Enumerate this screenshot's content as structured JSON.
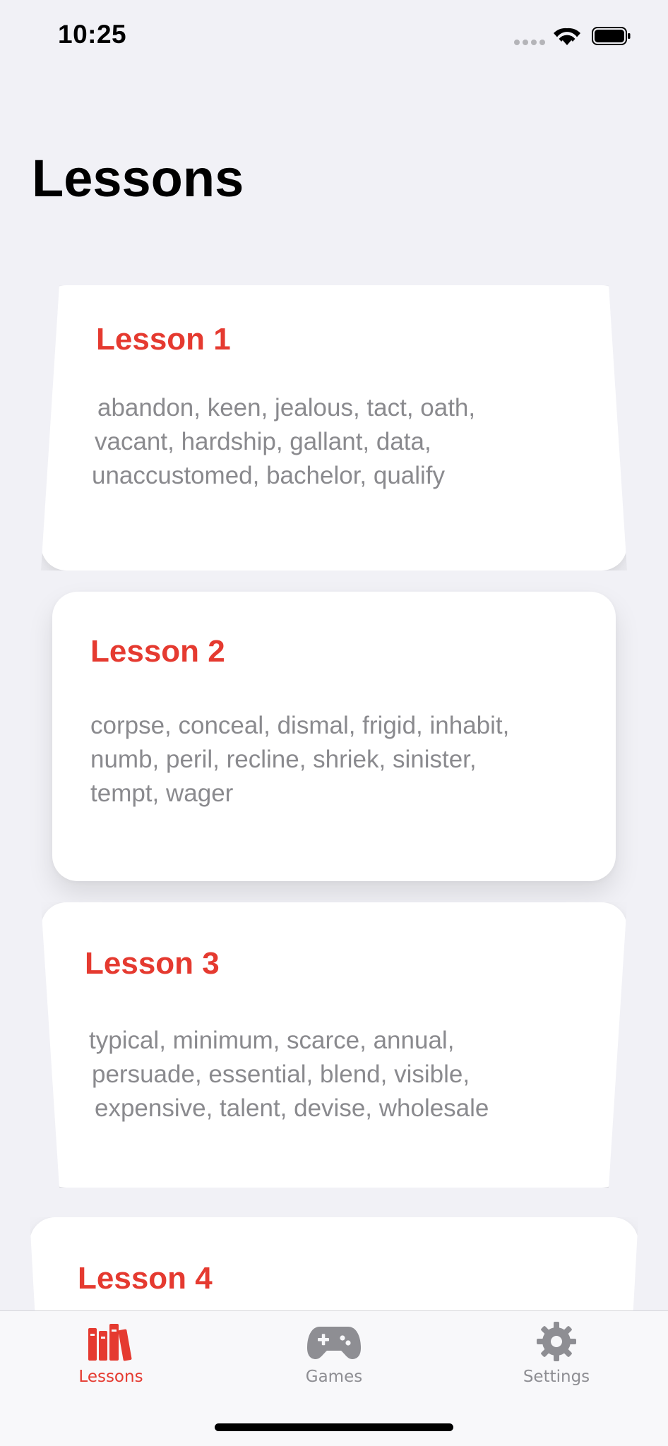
{
  "status_bar": {
    "time": "10:25"
  },
  "page_title": "Lessons",
  "lessons": [
    {
      "title": "Lesson 1",
      "words": [
        "abandon, keen, jealous, tact, oath,",
        "vacant, hardship, gallant, data,",
        "unaccustomed, bachelor, qualify"
      ]
    },
    {
      "title": "Lesson 2",
      "words": [
        "corpse, conceal, dismal, frigid, inhabit,",
        "numb, peril, recline, shriek, sinister,",
        "tempt, wager"
      ]
    },
    {
      "title": "Lesson 3",
      "words": [
        "typical, minimum, scarce, annual,",
        "persuade, essential, blend, visible,",
        "expensive, talent, devise, wholesale"
      ]
    },
    {
      "title": "Lesson 4",
      "words": []
    }
  ],
  "tabs": [
    {
      "label": "Lessons",
      "icon": "books-icon",
      "active": true
    },
    {
      "label": "Games",
      "icon": "gamecontroller-icon",
      "active": false
    },
    {
      "label": "Settings",
      "icon": "gear-icon",
      "active": false
    }
  ],
  "colors": {
    "accent": "#e53a30",
    "secondary_text": "#8a8a8e",
    "inactive_tab": "#8e8e93",
    "background": "#f1f1f6"
  }
}
